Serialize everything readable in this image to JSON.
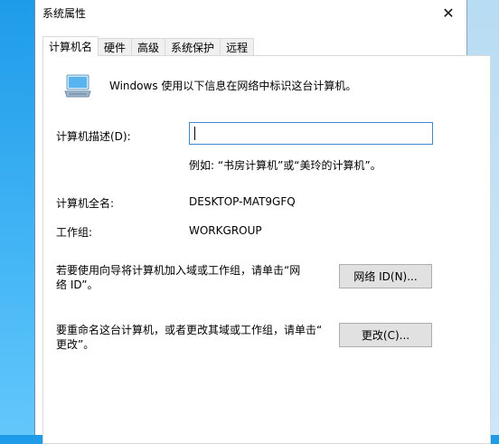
{
  "window": {
    "title": "系统属性",
    "close_label": "✕"
  },
  "tabs": [
    {
      "label": "计算机名",
      "active": true
    },
    {
      "label": "硬件",
      "active": false
    },
    {
      "label": "高级",
      "active": false
    },
    {
      "label": "系统保护",
      "active": false
    },
    {
      "label": "远程",
      "active": false
    }
  ],
  "computer_name_tab": {
    "icon": "computer-icon",
    "intro": "Windows 使用以下信息在网络中标识这台计算机。",
    "description_label": "计算机描述(D):",
    "description_value": "",
    "description_example": "例如: “书房计算机”或“美玲的计算机”。",
    "full_name_label": "计算机全名:",
    "full_name_value": "DESKTOP-MAT9GFQ",
    "workgroup_label": "工作组:",
    "workgroup_value": "WORKGROUP",
    "network_id_text_line1": "若要使用向导将计算机加入域或工作组，请单击“网",
    "network_id_text_line2": "络 ID”。",
    "network_id_button": "网络 ID(N)...",
    "rename_text_line1": "要重命名这台计算机，或者更改其域或工作组，请单击“",
    "rename_text_line2": "更改”。",
    "change_button": "更改(C)..."
  },
  "colors": {
    "accent": "#3f87cf",
    "desktop": "#1e9be8",
    "button_face": "#e1e1e1"
  }
}
